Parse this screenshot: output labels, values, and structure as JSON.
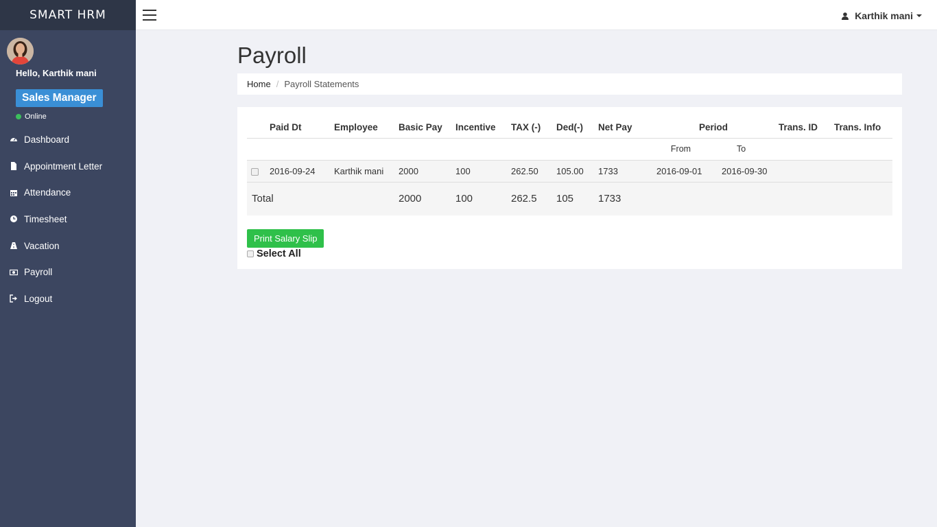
{
  "brand": "SMART HRM",
  "profile": {
    "greeting": "Hello, Karthik mani",
    "role": "Sales Manager",
    "status": "Online"
  },
  "sidebar": {
    "items": [
      {
        "label": "Dashboard",
        "icon": "dashboard-icon"
      },
      {
        "label": "Appointment Letter",
        "icon": "file-icon"
      },
      {
        "label": "Attendance",
        "icon": "calendar-icon"
      },
      {
        "label": "Timesheet",
        "icon": "clock-icon"
      },
      {
        "label": "Vacation",
        "icon": "road-icon"
      },
      {
        "label": "Payroll",
        "icon": "money-icon"
      },
      {
        "label": "Logout",
        "icon": "sign-out-icon"
      }
    ]
  },
  "header": {
    "user_name": "Karthik mani"
  },
  "page": {
    "title": "Payroll",
    "breadcrumb": {
      "home": "Home",
      "current": "Payroll Statements"
    }
  },
  "table": {
    "headers": {
      "paid_dt": "Paid Dt",
      "employee": "Employee",
      "basic_pay": "Basic Pay",
      "incentive": "Incentive",
      "tax": "TAX (-)",
      "ded": "Ded(-)",
      "net_pay": "Net Pay",
      "period": "Period",
      "trans_id": "Trans. ID",
      "trans_info": "Trans. Info"
    },
    "subheaders": {
      "from": "From",
      "to": "To"
    },
    "row": {
      "paid_dt": "2016-09-24",
      "employee": "Karthik mani",
      "basic_pay": "2000",
      "incentive": "100",
      "tax": "262.50",
      "ded": "105.00",
      "net_pay": "1733",
      "from": "2016-09-01",
      "to": "2016-09-30",
      "trans_id": "",
      "trans_info": ""
    },
    "total": {
      "label": "Total",
      "basic_pay": "2000",
      "incentive": "100",
      "tax": "262.5",
      "ded": "105",
      "net_pay": "1733"
    }
  },
  "actions": {
    "print_label": "Print Salary Slip",
    "select_all_label": "Select All"
  },
  "colors": {
    "sidebar_bg": "#3c4660",
    "brand_bg": "#2e3647",
    "role_badge": "#3a8fd6",
    "online_dot": "#3cbf5c",
    "print_button": "#2fc04a",
    "page_bg": "#f0f1f6"
  }
}
